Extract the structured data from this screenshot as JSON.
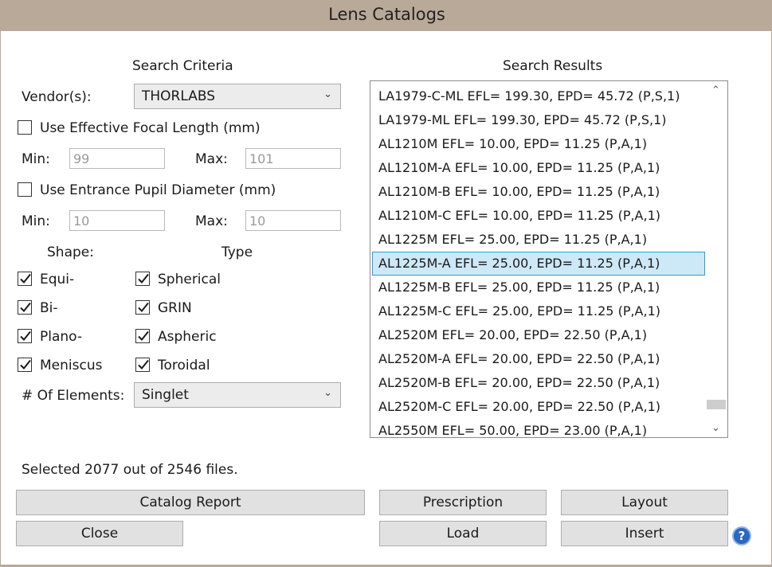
{
  "window": {
    "title": "Lens Catalogs"
  },
  "criteria": {
    "heading": "Search Criteria",
    "vendor_label": "Vendor(s):",
    "vendor_value": "THORLABS",
    "efl_checkbox_label": "Use Effective Focal Length (mm)",
    "efl_checked": false,
    "efl_min_label": "Min:",
    "efl_min_value": "99",
    "efl_max_label": "Max:",
    "efl_max_value": "101",
    "epd_checkbox_label": "Use Entrance Pupil Diameter (mm)",
    "epd_checked": false,
    "epd_min_label": "Min:",
    "epd_min_value": "10",
    "epd_max_label": "Max:",
    "epd_max_value": "10",
    "shape_heading": "Shape:",
    "type_heading": "Type",
    "shapes": [
      {
        "label": "Equi-",
        "checked": true
      },
      {
        "label": "Bi-",
        "checked": true
      },
      {
        "label": "Plano-",
        "checked": true
      },
      {
        "label": "Meniscus",
        "checked": true
      }
    ],
    "types": [
      {
        "label": "Spherical",
        "checked": true
      },
      {
        "label": "GRIN",
        "checked": true
      },
      {
        "label": "Aspheric",
        "checked": true
      },
      {
        "label": "Toroidal",
        "checked": true
      }
    ],
    "elements_label": "# Of Elements:",
    "elements_value": "Singlet"
  },
  "results": {
    "heading": "Search Results",
    "selected_index": 7,
    "items": [
      "LA1979-C-ML EFL= 199.30, EPD= 45.72 (P,S,1)",
      "LA1979-ML EFL= 199.30, EPD= 45.72 (P,S,1)",
      "AL1210M EFL= 10.00, EPD= 11.25 (P,A,1)",
      "AL1210M-A EFL= 10.00, EPD= 11.25 (P,A,1)",
      "AL1210M-B EFL= 10.00, EPD= 11.25 (P,A,1)",
      "AL1210M-C EFL= 10.00, EPD= 11.25 (P,A,1)",
      "AL1225M EFL= 25.00, EPD= 11.25 (P,A,1)",
      "AL1225M-A EFL= 25.00, EPD= 11.25 (P,A,1)",
      "AL1225M-B EFL= 25.00, EPD= 11.25 (P,A,1)",
      "AL1225M-C EFL= 25.00, EPD= 11.25 (P,A,1)",
      "AL2520M EFL= 20.00, EPD= 22.50 (P,A,1)",
      "AL2520M-A EFL= 20.00, EPD= 22.50 (P,A,1)",
      "AL2520M-B EFL= 20.00, EPD= 22.50 (P,A,1)",
      "AL2520M-C EFL= 20.00, EPD= 22.50 (P,A,1)",
      "AL2550M EFL= 50.00, EPD= 23.00 (P,A,1)"
    ]
  },
  "status_text": "Selected 2077 out of 2546 files.",
  "buttons": {
    "catalog_report": "Catalog Report",
    "prescription": "Prescription",
    "layout": "Layout",
    "close": "Close",
    "load": "Load",
    "insert": "Insert",
    "help": "?"
  },
  "icons": {
    "dropdown": "chevron-down-icon",
    "scroll_up": "chevron-up-icon",
    "scroll_down": "chevron-down-icon",
    "help": "help-icon"
  },
  "colors": {
    "titlebar": "#b9a998",
    "selection_fill": "#cde8f7",
    "selection_border": "#26a0da",
    "help": "#2b66c0"
  }
}
